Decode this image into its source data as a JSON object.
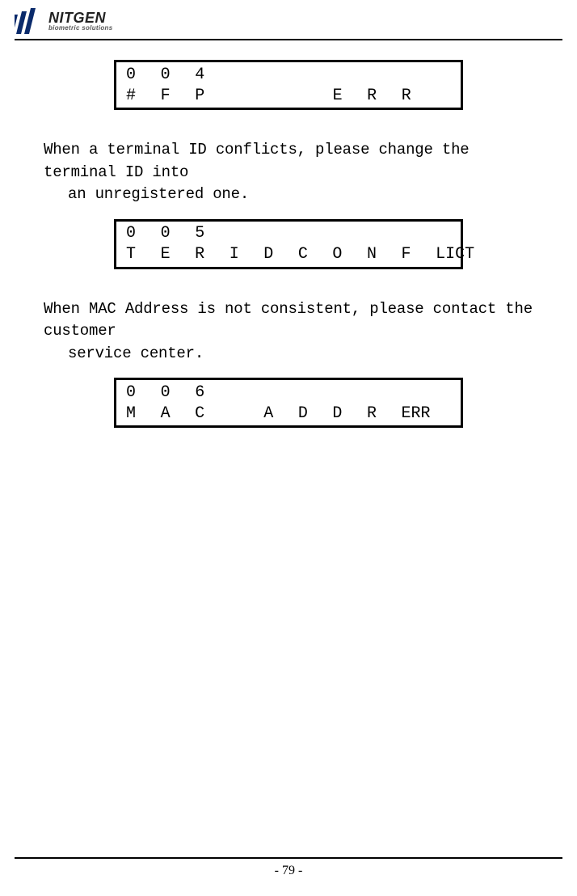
{
  "header": {
    "brand_name": "NITGEN",
    "brand_sub": "biometric solutions"
  },
  "lcd1": {
    "row1": [
      "0",
      "0",
      "4",
      "",
      "",
      "",
      "",
      "",
      "",
      ""
    ],
    "row2": [
      "#",
      "F",
      "P",
      "",
      "",
      "",
      "E",
      "R",
      "R",
      ""
    ]
  },
  "para1_line1": "When a terminal ID conflicts, please change the terminal ID into",
  "para1_line2": "an unregistered one.",
  "lcd2": {
    "row1": [
      "0",
      "0",
      "5",
      "",
      "",
      "",
      "",
      "",
      "",
      ""
    ],
    "row2": [
      "T",
      "E",
      "R",
      "I",
      "D",
      "C",
      "O",
      "N",
      "F",
      "LICT"
    ]
  },
  "para2_line1": "When MAC Address is not consistent, please contact the customer",
  "para2_line2": "service center.",
  "lcd3": {
    "row1": [
      "0",
      "0",
      "6",
      "",
      "",
      "",
      "",
      "",
      "",
      ""
    ],
    "row2": [
      "M",
      "A",
      "C",
      "",
      "A",
      "D",
      "D",
      "R",
      "ERR",
      ""
    ]
  },
  "page_number": "- 79 -"
}
